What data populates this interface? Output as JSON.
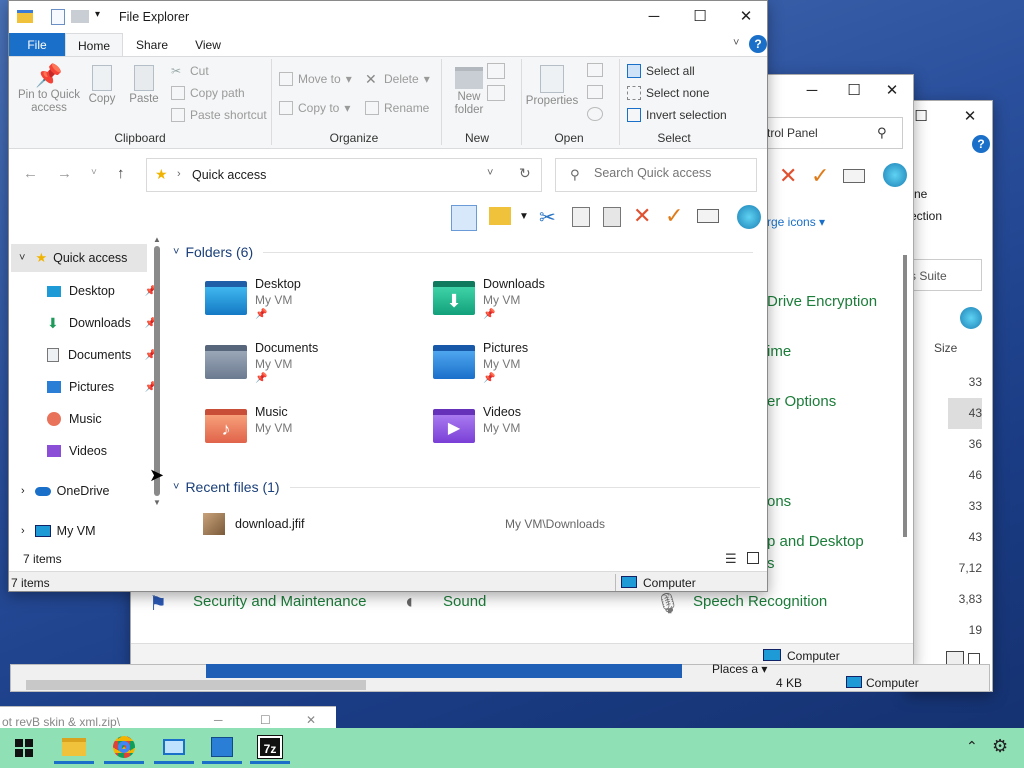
{
  "background_windows": {
    "control_panel": {
      "address_fragment": "trol Panel",
      "view_link": "rge icons",
      "links": [
        "Drive Encryption",
        "ime",
        "er Options",
        "ons",
        "p and Desktop",
        "s"
      ],
      "bottom_items": [
        "Security and Maintenance",
        "Sound",
        "Speech Recognition"
      ],
      "status": "Computer"
    },
    "archive_window": {
      "ribbon_fragment_1": "ne",
      "ribbon_fragment_2": "ection",
      "search_fragment": "s Suite",
      "size_header": "Size",
      "sizes": [
        "33",
        "43",
        "36",
        "46",
        "33",
        "43",
        "7,12",
        "3,83",
        "19"
      ],
      "status_size": "4 KB",
      "status_computer": "Computer",
      "places": "Places a"
    },
    "bottom_window": {
      "title": "ot revB skin & xml.zip\\"
    }
  },
  "explorer": {
    "title": "File Explorer",
    "tabs": [
      "File",
      "Home",
      "Share",
      "View"
    ],
    "ribbon": {
      "clipboard": {
        "pin": "Pin to Quick access",
        "copy": "Copy",
        "paste": "Paste",
        "cut": "Cut",
        "copy_path": "Copy path",
        "paste_shortcut": "Paste shortcut",
        "label": "Clipboard"
      },
      "organize": {
        "move_to": "Move to",
        "copy_to": "Copy to",
        "delete": "Delete",
        "rename": "Rename",
        "label": "Organize"
      },
      "new": {
        "new_folder": "New folder",
        "label": "New"
      },
      "open": {
        "properties": "Properties",
        "label": "Open"
      },
      "select": {
        "select_all": "Select all",
        "select_none": "Select none",
        "invert": "Invert selection",
        "label": "Select"
      }
    },
    "address": "Quick access",
    "search_placeholder": "Search Quick access",
    "nav": {
      "quick_access": "Quick access",
      "items": [
        "Desktop",
        "Downloads",
        "Documents",
        "Pictures",
        "Music",
        "Videos"
      ],
      "onedrive": "OneDrive",
      "myvm": "My VM"
    },
    "folders_header": "Folders (6)",
    "folders": [
      {
        "name": "Desktop",
        "sub": "My VM"
      },
      {
        "name": "Downloads",
        "sub": "My VM"
      },
      {
        "name": "Documents",
        "sub": "My VM"
      },
      {
        "name": "Pictures",
        "sub": "My VM"
      },
      {
        "name": "Music",
        "sub": "My VM"
      },
      {
        "name": "Videos",
        "sub": "My VM"
      }
    ],
    "recent_header": "Recent files (1)",
    "recent": [
      {
        "name": "download.jfif",
        "path": "My VM\\Downloads"
      }
    ],
    "items_count": "7 items",
    "status_items": "7 items",
    "status_computer": "Computer"
  },
  "colors": {
    "accent": "#1a6fc9",
    "cp_link": "#1c7d3a",
    "taskbar": "#8fe0b5"
  }
}
